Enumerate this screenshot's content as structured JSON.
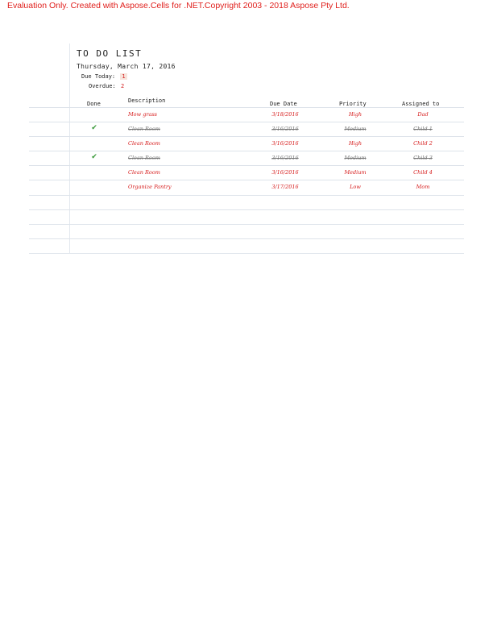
{
  "watermark": "Evaluation Only. Created with Aspose.Cells for .NET.Copyright 2003 - 2018 Aspose Pty Ltd.",
  "title": "TO DO LIST",
  "date": "Thursday, March 17, 2016",
  "due_today": {
    "label": "Due Today:",
    "value": "1"
  },
  "overdue": {
    "label": "Overdue:",
    "value": "2"
  },
  "columns": [
    "Done",
    "Description",
    "Due Date",
    "Priority",
    "Assigned to"
  ],
  "rows": [
    {
      "done": false,
      "description": "Mow grass",
      "due": "3/18/2016",
      "priority": "High",
      "assigned": "Dad"
    },
    {
      "done": true,
      "description": "Clean Room",
      "due": "3/16/2016",
      "priority": "Medium",
      "assigned": "Child 1"
    },
    {
      "done": false,
      "description": "Clean Room",
      "due": "3/16/2016",
      "priority": "High",
      "assigned": "Child 2"
    },
    {
      "done": true,
      "description": "Clean Room",
      "due": "3/16/2016",
      "priority": "Medium",
      "assigned": "Child 3"
    },
    {
      "done": false,
      "description": "Clean Room",
      "due": "3/16/2016",
      "priority": "Medium",
      "assigned": "Child 4"
    },
    {
      "done": false,
      "description": "Organize Pantry",
      "due": "3/17/2016",
      "priority": "Low",
      "assigned": "Mom"
    }
  ],
  "colors": {
    "open": "#d61a1a",
    "done": "#777777",
    "check": "#3a9a3a",
    "watermark": "#e0201d"
  },
  "icons": {
    "done_marker": "checkmark-icon"
  }
}
